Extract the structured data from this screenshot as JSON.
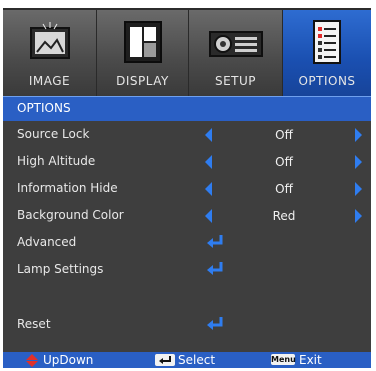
{
  "tabs": [
    {
      "label": "IMAGE",
      "icon": "image-icon",
      "active": false
    },
    {
      "label": "DISPLAY",
      "icon": "display-icon",
      "active": false
    },
    {
      "label": "SETUP",
      "icon": "projector-icon",
      "active": false
    },
    {
      "label": "OPTIONS",
      "icon": "document-options-icon",
      "active": true
    }
  ],
  "title": "OPTIONS",
  "rows": [
    {
      "label": "Source Lock",
      "value": "Off",
      "kind": "select"
    },
    {
      "label": "High Altitude",
      "value": "Off",
      "kind": "select"
    },
    {
      "label": "Information Hide",
      "value": "Off",
      "kind": "select"
    },
    {
      "label": "Background Color",
      "value": "Red",
      "kind": "select"
    },
    {
      "label": "Advanced",
      "kind": "enter"
    },
    {
      "label": "Lamp Settings",
      "kind": "enter"
    },
    {
      "label": "Reset",
      "kind": "enter"
    }
  ],
  "footer": {
    "updown": "UpDown",
    "select": "Select",
    "exit": "Exit",
    "menu_key": "Menu"
  },
  "colors": {
    "accent_blue": "#2a5fc4",
    "arrow_blue": "#2f7df0",
    "updown_red": "#e0302a",
    "panel_bg": "#3e3e3e"
  }
}
